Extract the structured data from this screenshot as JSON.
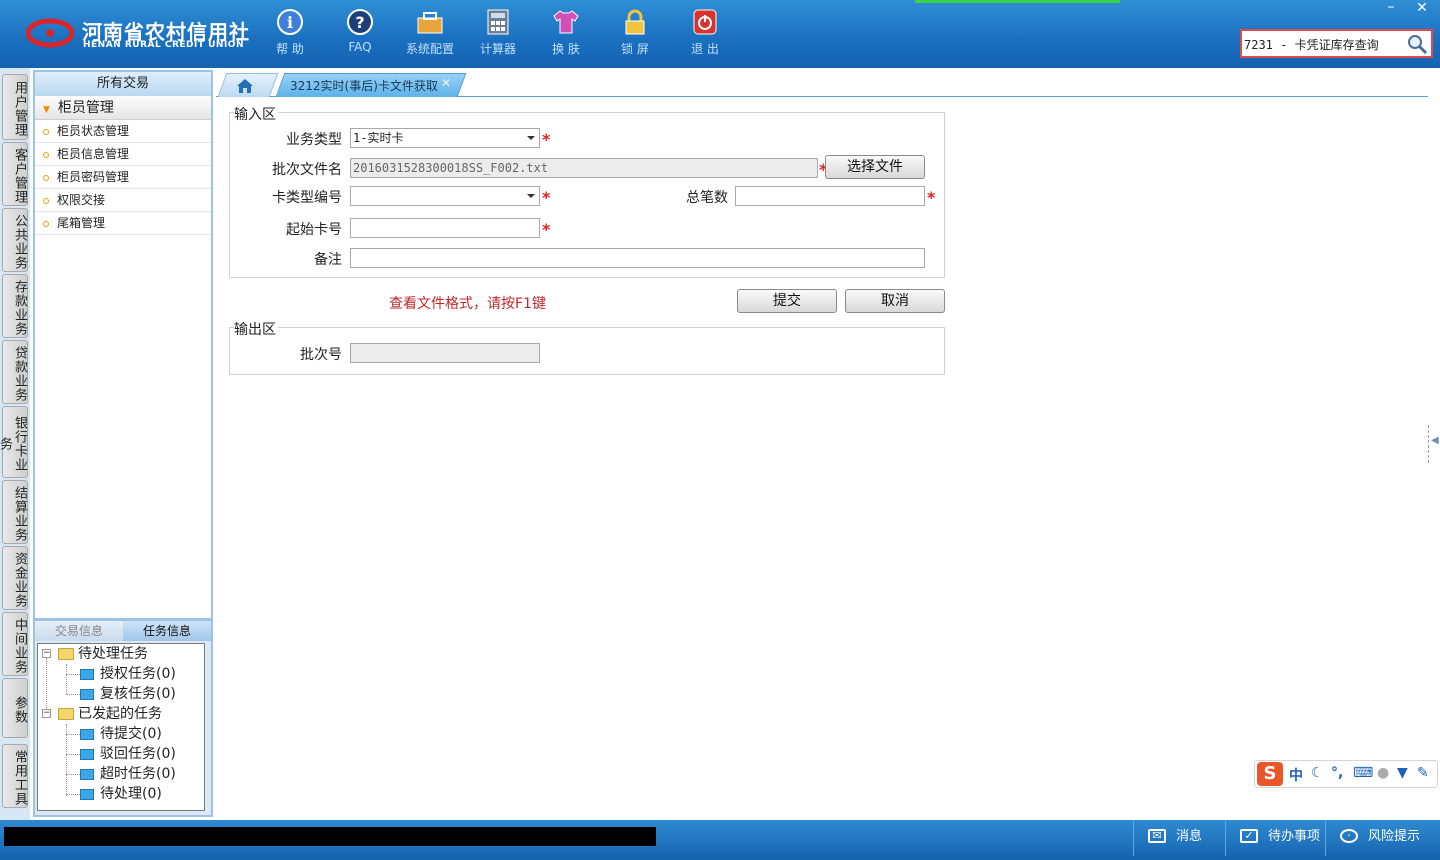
{
  "logo": {
    "cn": "河南省农村信用社",
    "en": "HENAN RURAL CREDIT UNION"
  },
  "toolbar": [
    {
      "label": "帮 助",
      "icon": "info-icon"
    },
    {
      "label": "FAQ",
      "icon": "question-icon"
    },
    {
      "label": "系统配置",
      "icon": "toolbox-icon"
    },
    {
      "label": "计算器",
      "icon": "calculator-icon"
    },
    {
      "label": "换 肤",
      "icon": "shirt-icon"
    },
    {
      "label": "锁 屏",
      "icon": "lock-icon"
    },
    {
      "label": "退 出",
      "icon": "power-icon"
    }
  ],
  "window": {
    "minimize": "–",
    "close": "✕"
  },
  "search": {
    "value": "7231 - 卡凭证库存查询"
  },
  "vertical_tabs": [
    "用户管理",
    "客户管理",
    "公共业务",
    "存款业务",
    "贷款业务",
    "银行卡业务",
    "结算业务",
    "资金业务",
    "中间业务",
    "参数",
    "常用工具"
  ],
  "menu": {
    "header": "所有交易",
    "group": "柜员管理",
    "items": [
      "柜员状态管理",
      "柜员信息管理",
      "柜员密码管理",
      "权限交接",
      "尾箱管理"
    ]
  },
  "tasks": {
    "tabs": [
      "交易信息",
      "任务信息"
    ],
    "groups": [
      {
        "label": "待处理任务",
        "children": [
          "授权任务(0)",
          "复核任务(0)"
        ]
      },
      {
        "label": "已发起的任务",
        "children": [
          "待提交(0)",
          "驳回任务(0)",
          "超时任务(0)",
          "待处理(0)"
        ]
      }
    ]
  },
  "tabs": {
    "active": "3212实时(事后)卡文件获取",
    "close": "✕"
  },
  "form": {
    "input_section": "输入区",
    "output_section": "输出区",
    "business_type_label": "业务类型",
    "business_type_value": "1-实时卡",
    "batch_file_label": "批次文件名",
    "batch_file_value": "2016031528300018SS_F002.txt",
    "select_file_button": "选择文件",
    "card_type_label": "卡类型编号",
    "card_type_value": "",
    "total_count_label": "总笔数",
    "total_count_value": "",
    "start_card_label": "起始卡号",
    "start_card_value": "",
    "remark_label": "备注",
    "remark_value": "",
    "required_mark": "*",
    "hint": "查看文件格式，请按F1键",
    "submit_button": "提交",
    "cancel_button": "取消",
    "batch_no_label": "批次号",
    "batch_no_value": ""
  },
  "ime": {
    "logo": "S",
    "lang": "中"
  },
  "statusbar": {
    "messages": "消息",
    "todo": "待办事项",
    "risk": "风险提示"
  },
  "colors": {
    "header": "#1a6fbf",
    "accent": "#5db2ea",
    "required": "#e02020",
    "hint": "#c0282a"
  }
}
